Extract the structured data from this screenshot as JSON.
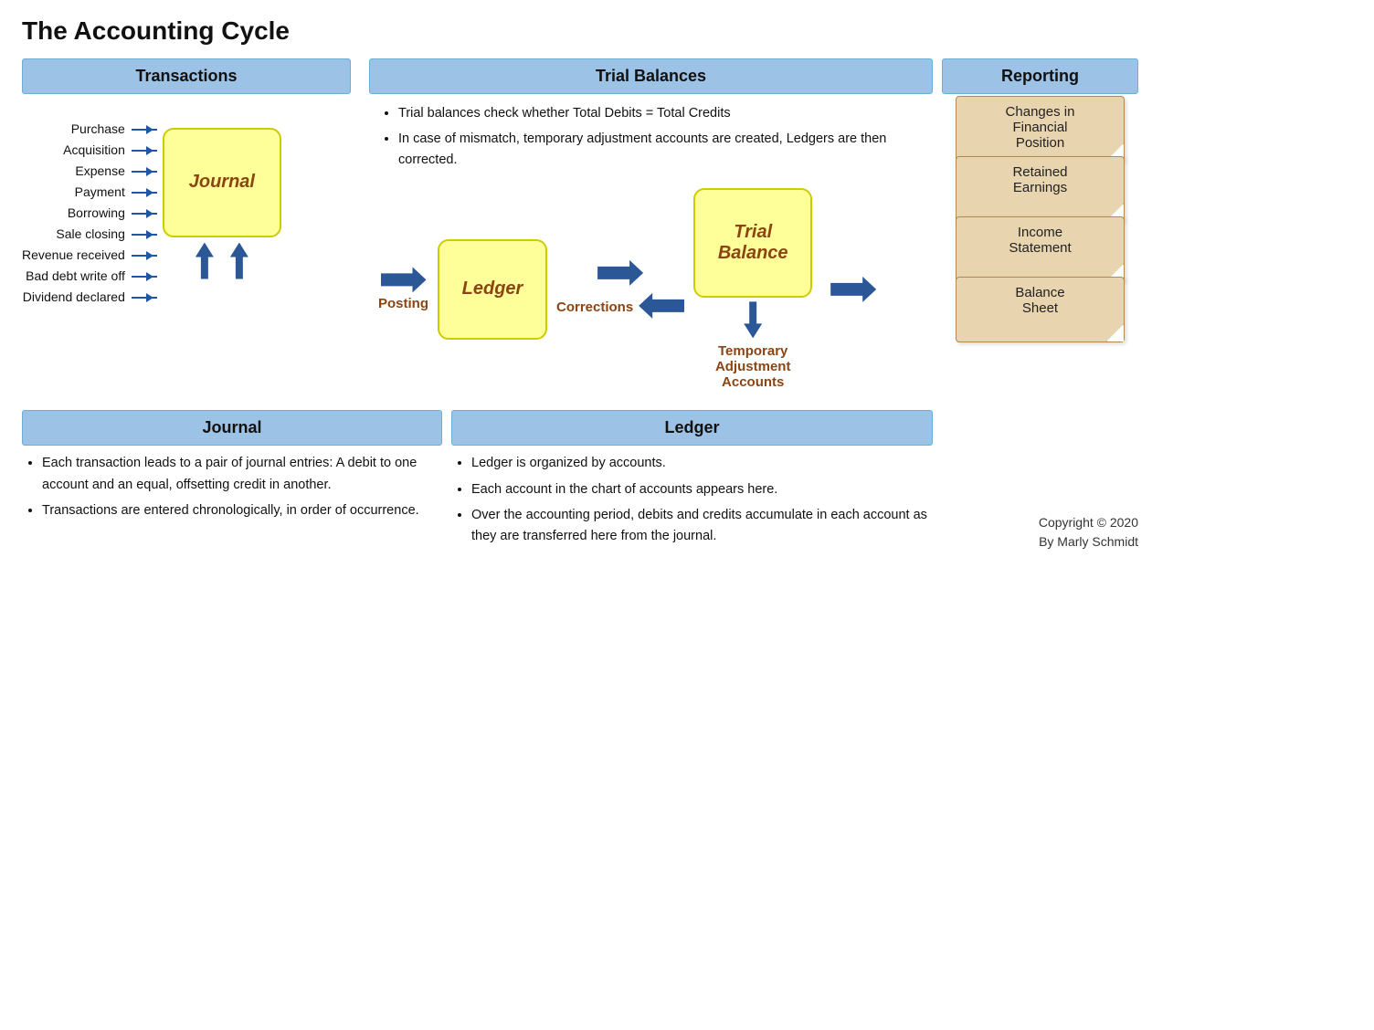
{
  "title": "The Accounting Cycle",
  "columns": {
    "transactions": "Transactions",
    "trial_balances": "Trial Balances",
    "reporting": "Reporting"
  },
  "transactions": {
    "items": [
      "Purchase",
      "Acquisition",
      "Expense",
      "Payment",
      "Borrowing",
      "Sale closing",
      "Revenue received",
      "Bad debt write off",
      "Dividend declared"
    ]
  },
  "diagram": {
    "journal_label": "Journal",
    "ledger_label": "Ledger",
    "trial_balance_label": "Trial\nBalance",
    "posting_label": "Posting",
    "corrections_label": "Corrections",
    "temp_adj_label": "Temporary\nAdjustment\nAccounts"
  },
  "trial_balances": {
    "bullet1": "Trial balances check whether Total Debits = Total Credits",
    "bullet2": "In case of mismatch, temporary adjustment accounts are created, Ledgers are then corrected."
  },
  "reporting_docs": [
    "Changes in\nFinancial\nPosition",
    "Retained\nEarnings",
    "Income\nStatement",
    "Balance\nSheet"
  ],
  "bottom": {
    "journal_header": "Journal",
    "journal_bullets": [
      "Each transaction leads to a pair of journal entries: A debit to one account and an equal, offsetting credit in another.",
      "Transactions are entered chronologically, in order of occurrence."
    ],
    "ledger_header": "Ledger",
    "ledger_bullets": [
      "Ledger is organized by accounts.",
      "Each account in the chart of accounts appears here.",
      "Over the accounting period, debits and credits accumulate in each account as they are transferred here from the journal."
    ],
    "copyright": "Copyright © 2020\nBy Marly Schmidt"
  }
}
